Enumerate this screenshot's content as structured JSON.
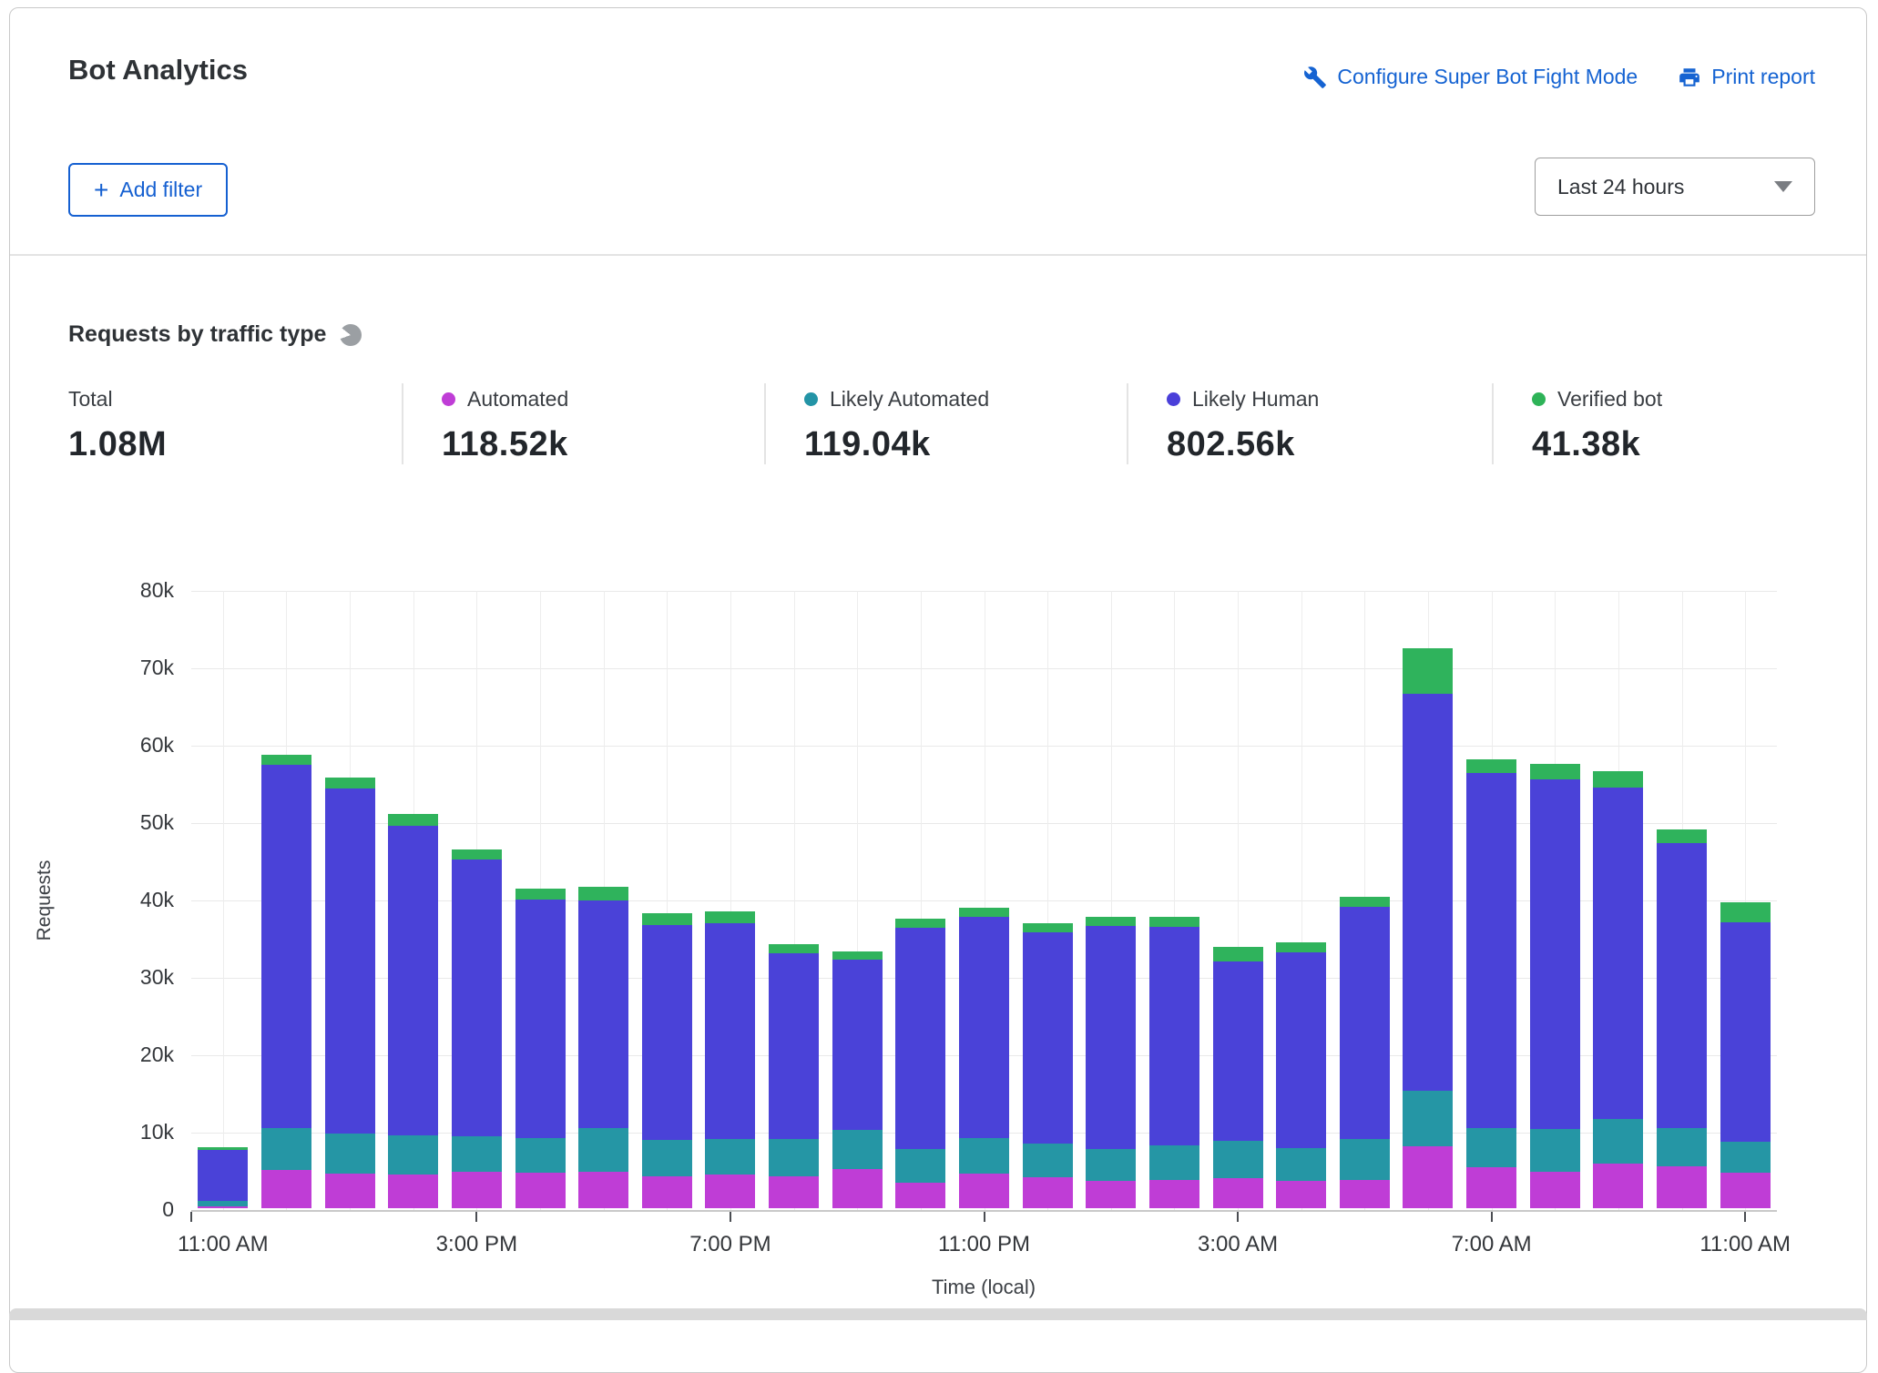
{
  "header": {
    "title": "Bot Analytics",
    "configure_link": "Configure Super Bot Fight Mode",
    "print_link": "Print report",
    "add_filter_label": "Add filter",
    "time_range_value": "Last 24 hours"
  },
  "section": {
    "title": "Requests by traffic type"
  },
  "stats": [
    {
      "label": "Total",
      "value": "1.08M",
      "color": null
    },
    {
      "label": "Automated",
      "value": "118.52k",
      "color": "#bf3dd6"
    },
    {
      "label": "Likely Automated",
      "value": "119.04k",
      "color": "#2394a6"
    },
    {
      "label": "Likely Human",
      "value": "802.56k",
      "color": "#4a3fd9"
    },
    {
      "label": "Verified bot",
      "value": "41.38k",
      "color": "#2eb358"
    }
  ],
  "colors": {
    "link_blue": "#1563d2",
    "automated": "#bf3dd6",
    "likely_automated": "#2596a5",
    "likely_human": "#4a42d8",
    "verified_bot": "#2fb35c"
  },
  "chart_data": {
    "type": "bar",
    "stacked": true,
    "title": "Requests by traffic type",
    "xlabel": "Time (local)",
    "ylabel": "Requests",
    "ylim": [
      0,
      80000
    ],
    "ytick_step": 10000,
    "ytick_format": "k",
    "grid": true,
    "categories_count": 25,
    "x_interval": "1 hour",
    "xticks": [
      {
        "index": 0,
        "label": "11:00 AM"
      },
      {
        "index": 4,
        "label": "3:00 PM"
      },
      {
        "index": 8,
        "label": "7:00 PM"
      },
      {
        "index": 12,
        "label": "11:00 PM"
      },
      {
        "index": 16,
        "label": "3:00 AM"
      },
      {
        "index": 20,
        "label": "7:00 AM"
      },
      {
        "index": 24,
        "label": "11:00 AM"
      }
    ],
    "series": [
      {
        "key": "automated",
        "name": "Automated",
        "color": "#bf3dd6",
        "values": [
          250,
          4900,
          4500,
          4400,
          4700,
          4600,
          4700,
          4100,
          4350,
          4100,
          5100,
          3300,
          4500,
          4000,
          3500,
          3700,
          3900,
          3500,
          3700,
          8000,
          5250,
          4700,
          5800,
          5450,
          4600
        ]
      },
      {
        "key": "likely_automated",
        "name": "Likely Automated",
        "color": "#2596a5",
        "values": [
          700,
          5500,
          5150,
          5000,
          4600,
          4500,
          5700,
          4700,
          4650,
          4800,
          5050,
          4300,
          4600,
          4400,
          4200,
          4400,
          4800,
          4300,
          5300,
          7200,
          5150,
          5500,
          5700,
          4850,
          4000
        ]
      },
      {
        "key": "likely_human",
        "name": "Likely Human",
        "color": "#4a42d8",
        "values": [
          6550,
          46900,
          44550,
          40000,
          35800,
          30800,
          29400,
          27800,
          27800,
          24000,
          21950,
          28600,
          28500,
          27200,
          28800,
          28300,
          23200,
          25300,
          29900,
          51300,
          45800,
          45200,
          42900,
          36900,
          28400
        ]
      },
      {
        "key": "verified_bot",
        "name": "Verified bot",
        "color": "#2fb35c",
        "values": [
          400,
          1300,
          1500,
          1600,
          1200,
          1400,
          1700,
          1500,
          1600,
          1200,
          1100,
          1200,
          1200,
          1200,
          1200,
          1300,
          1900,
          1300,
          1300,
          5800,
          1800,
          2000,
          2100,
          1800,
          2500
        ]
      }
    ]
  }
}
